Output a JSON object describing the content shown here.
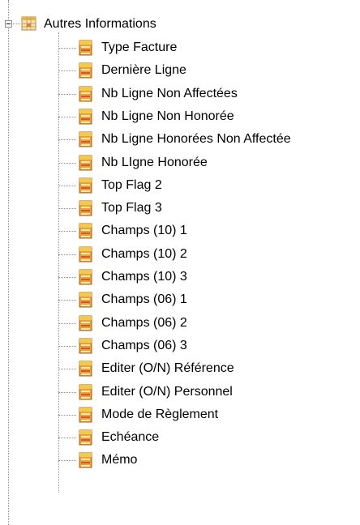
{
  "tree": {
    "parent": {
      "label": "Autres Informations",
      "icon": "table-icon",
      "expanded": true
    },
    "children": [
      {
        "label": "Type Facture",
        "icon": "field-icon"
      },
      {
        "label": "Dernière Ligne",
        "icon": "field-icon"
      },
      {
        "label": "Nb Ligne Non Affectées",
        "icon": "field-icon"
      },
      {
        "label": "Nb Ligne Non Honorée",
        "icon": "field-icon"
      },
      {
        "label": "Nb Ligne Honorées Non Affectée",
        "icon": "field-icon"
      },
      {
        "label": "Nb LIgne Honorée",
        "icon": "field-icon"
      },
      {
        "label": "Top Flag 2",
        "icon": "field-icon"
      },
      {
        "label": "Top Flag 3",
        "icon": "field-icon"
      },
      {
        "label": "Champs (10) 1",
        "icon": "field-icon"
      },
      {
        "label": "Champs (10) 2",
        "icon": "field-icon"
      },
      {
        "label": "Champs (10) 3",
        "icon": "field-icon"
      },
      {
        "label": "Champs (06) 1",
        "icon": "field-icon"
      },
      {
        "label": "Champs (06) 2",
        "icon": "field-icon"
      },
      {
        "label": "Champs (06) 3",
        "icon": "field-icon"
      },
      {
        "label": "Editer (O/N) Référence",
        "icon": "field-icon"
      },
      {
        "label": "Editer (O/N) Personnel",
        "icon": "field-icon"
      },
      {
        "label": "Mode de Règlement",
        "icon": "field-icon"
      },
      {
        "label": "Echéance",
        "icon": "field-icon"
      },
      {
        "label": "Mémo",
        "icon": "field-icon"
      }
    ]
  },
  "colors": {
    "connector": "#8c8c8c",
    "field_icon_top": "#f2c94c",
    "field_icon_body": "#e8a23a",
    "field_icon_stripe": "#d9552b",
    "table_icon_grid": "#c9a25a",
    "table_icon_fill": "#f4e2b8"
  }
}
